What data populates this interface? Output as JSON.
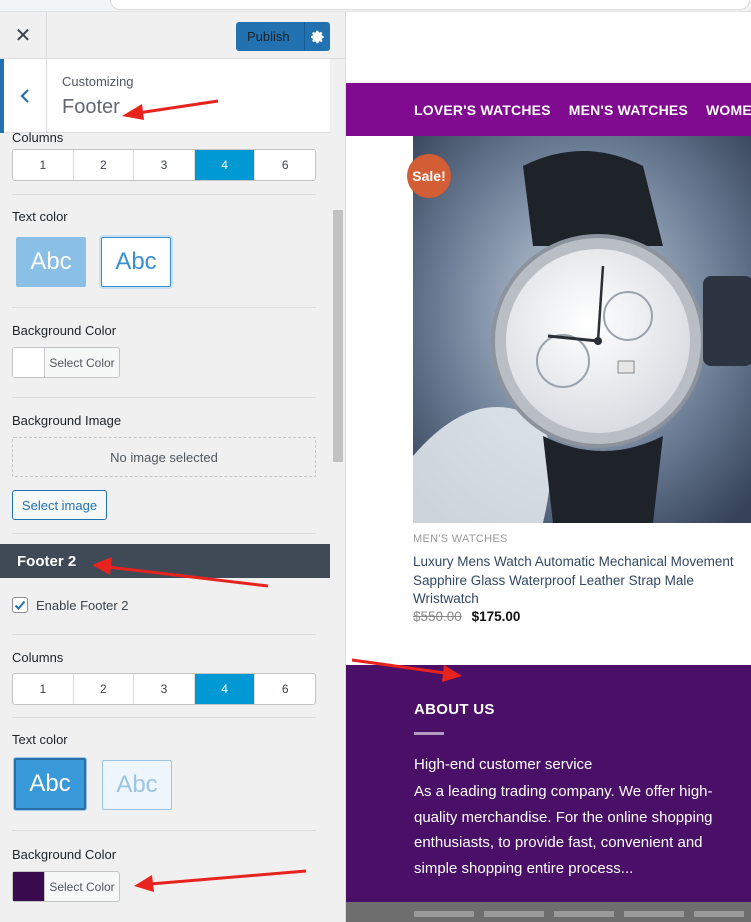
{
  "customizer": {
    "publish_label": "Publish",
    "customizing_label": "Customizing",
    "section_title": "Footer",
    "footer1": {
      "columns_label": "Columns",
      "column_options": [
        "1",
        "2",
        "3",
        "4",
        "6"
      ],
      "selected_columns": "4",
      "text_color_label": "Text color",
      "text_color_options": [
        "Abc",
        "Abc"
      ],
      "bg_color_label": "Background Color",
      "select_color_label": "Select Color",
      "bg_image_label": "Background Image",
      "no_image_text": "No image selected",
      "select_image_label": "Select image"
    },
    "footer2": {
      "title": "Footer 2",
      "enable_label": "Enable Footer 2",
      "enabled": true,
      "columns_label": "Columns",
      "column_options": [
        "1",
        "2",
        "3",
        "4",
        "6"
      ],
      "selected_columns": "4",
      "text_color_label": "Text color",
      "text_color_options": [
        "Abc",
        "Abc"
      ],
      "bg_color_label": "Background Color",
      "select_color_label": "Select Color",
      "bg_color_value": "#3a0a4e"
    }
  },
  "preview": {
    "nav_items": [
      "LOVER'S WATCHES",
      "MEN'S WATCHES",
      "WOMEN"
    ],
    "sale_badge": "Sale!",
    "product": {
      "category": "MEN'S WATCHES",
      "name": "Luxury Mens Watch Automatic Mechanical Movement Sapphire Glass Waterproof Leather Strap Male Wristwatch",
      "old_price": "$550.00",
      "new_price": "$175.00"
    },
    "footer": {
      "title": "ABOUT US",
      "subtitle": "High-end customer service",
      "text": "As a leading trading company. We offer high-quality merchandise. For the online shopping enthusiasts, to provide fast, convenient and simple shopping entire process..."
    }
  },
  "colors": {
    "accent_blue": "#2271b1",
    "active_column": "#0099d4",
    "nav_purple": "#800a8f",
    "footer_purple": "#4a0f66",
    "sale_orange": "#d35d34",
    "annotation_red": "#e8231e"
  }
}
